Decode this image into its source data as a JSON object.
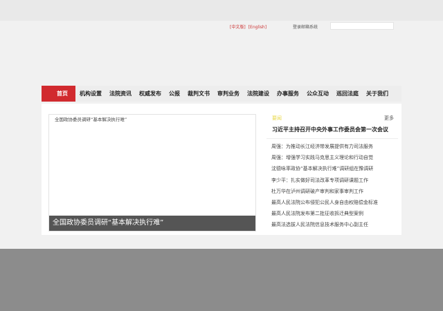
{
  "header": {
    "lang_cn": "[中文版]",
    "lang_en": "[English]",
    "login": "登录邮箱系统",
    "search_placeholder": ""
  },
  "nav": [
    "首页",
    "机构设置",
    "法院资讯",
    "权威发布",
    "公报",
    "裁判文书",
    "审判业务",
    "法院建设",
    "办事服务",
    "公众互动",
    "巡回法庭",
    "关于我们"
  ],
  "feature": {
    "top_title": "全国政协委员调研“基本解决执行难”",
    "caption": "全国政协委员调研“基本解决执行难”"
  },
  "news": {
    "label": "要闻",
    "more": "更多",
    "headline": "习近平主持召开中央外事工作委员会第一次会议",
    "items": [
      "周强：为推动长江经济带发展提供有力司法服务",
      "周强：增强学习实践马克思主义理论和行动自觉",
      "沈德咏率政协“基本解决执行难”调研组在豫调研",
      "李少平：扎实做好司法改革专项调研课题工作",
      "杜万华在泸州调研破产审判和家事审判工作",
      "最高人民法院公布侵犯公民人身自由权赔偿金标准",
      "最高人民法院发布第二批征收拆迁典型案例",
      "最高法选拔人民法院信息技术服务中心副主任"
    ]
  }
}
